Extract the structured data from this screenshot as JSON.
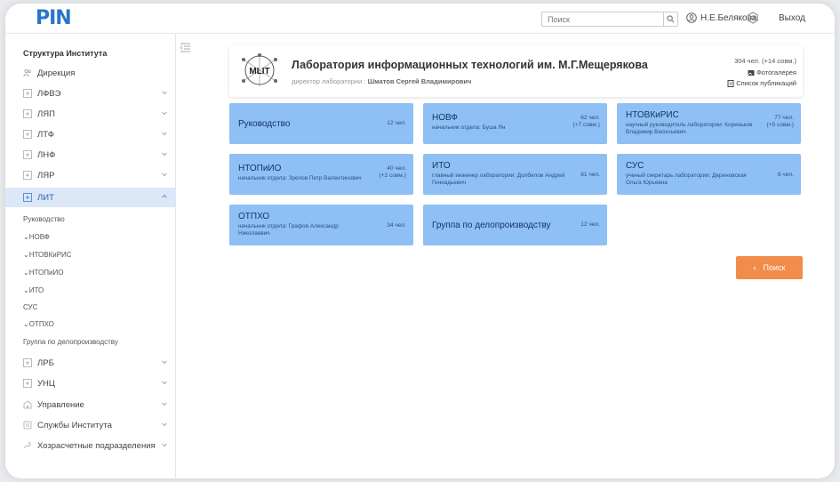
{
  "header": {
    "logo_text": "PIN",
    "search_placeholder": "Поиск",
    "user_name": "Н.Е.Белякова",
    "logout_label": "Выход"
  },
  "sidebar": {
    "title": "Структура Института",
    "items": [
      {
        "label": "Дирекция",
        "icon": "people-icon"
      },
      {
        "label": "ЛФВЭ",
        "icon": "atom-icon"
      },
      {
        "label": "ЛЯП",
        "icon": "atom-icon"
      },
      {
        "label": "ЛТФ",
        "icon": "atom-icon"
      },
      {
        "label": "ЛНФ",
        "icon": "atom-icon"
      },
      {
        "label": "ЛЯР",
        "icon": "atom-icon"
      },
      {
        "label": "ЛИТ",
        "icon": "atom-icon"
      }
    ],
    "subitems": [
      "Руководство",
      "НОВФ",
      "НТОВКиРИС",
      "НТОПиИО",
      "ИТО",
      "СУС",
      "ОТПХО",
      "Группа по делопроизводству"
    ],
    "items_after": [
      {
        "label": "ЛРБ",
        "icon": "atom-icon"
      },
      {
        "label": "УНЦ",
        "icon": "atom-icon"
      },
      {
        "label": "Управление",
        "icon": "building-icon"
      },
      {
        "label": "Службы Института",
        "icon": "services-icon"
      },
      {
        "label": "Хозрасчетные подразделения",
        "icon": "hands-icon"
      }
    ]
  },
  "lab": {
    "logo_text": "MLIT",
    "title": "Лаборатория информационных технологий им. М.Г.Мещерякова",
    "director_label": "директор лаборатории :",
    "director_name": "Шматов Сергей Владимирович",
    "count": "304 чел. (+14 совм.)",
    "photo_link": "Фотогалерея",
    "pubs_link": "Список публикаций"
  },
  "departments": [
    {
      "name": "Руководство",
      "head": "",
      "count": "12 чел.",
      "extra": ""
    },
    {
      "name": "НОВФ",
      "head": "начальник отдела: Буша Ян",
      "count": "62 чел.",
      "extra": "(+7 совм.)"
    },
    {
      "name": "НТОВКиРИС",
      "head": "научный руководитель лаборатории: Кореньков Владимир Васильевич",
      "count": "77 чел.",
      "extra": "(+5 совм.)"
    },
    {
      "name": "НТОПиИО",
      "head": "начальник отдела: Зрелов Петр Валентинович",
      "count": "40 чел.",
      "extra": "(+2 совм.)"
    },
    {
      "name": "ИТО",
      "head": "главный инженер лаборатории: Долбилов Андрей Геннадьевич",
      "count": "61 чел.",
      "extra": ""
    },
    {
      "name": "СУС",
      "head": "ученый секретарь лаборатории: Дереновская Ольга Юрьевна",
      "count": "6 чел.",
      "extra": ""
    },
    {
      "name": "ОТПХО",
      "head": "начальник отдела: Графов Александр Николаевич",
      "count": "34 чел.",
      "extra": ""
    },
    {
      "name": "Группа по делопроизводству",
      "head": "",
      "count": "12 чел.",
      "extra": ""
    }
  ],
  "back_button_label": "Поиск",
  "colors": {
    "accent": "#2a76c9",
    "dept_card": "#8ec0f5",
    "back_button": "#f28c4c",
    "active_item": "#dce8f8"
  }
}
